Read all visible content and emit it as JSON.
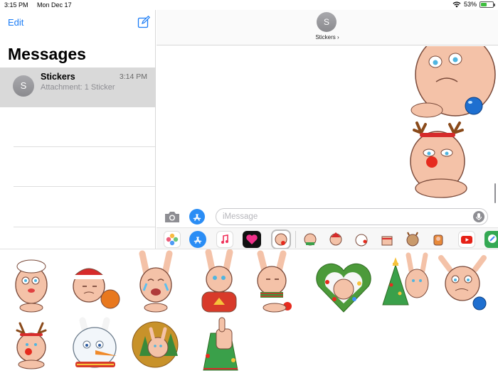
{
  "status": {
    "time": "3:15 PM",
    "date": "Mon Dec 17",
    "battery": "53%",
    "battery_level": 0.53
  },
  "sidebar": {
    "edit_label": "Edit",
    "title": "Messages"
  },
  "conversation": {
    "avatar_letter": "S",
    "name": "Stickers",
    "time": "3:14 PM",
    "preview": "Attachment: 1 Sticker"
  },
  "thread": {
    "avatar_letter": "S",
    "name": "Stickers ›"
  },
  "input": {
    "placeholder": "iMessage"
  },
  "colors": {
    "accent": "#1a7cf5",
    "selected_row": "#d9d9d9",
    "sticker_fur": "#f4c2a8",
    "battery": "#3fbf3f"
  },
  "apps": [
    "photos-app-icon",
    "app-store-app-icon",
    "music-app-icon",
    "digital-touch-app-icon",
    "stickers-app-icon",
    "sticker-pack-icon",
    "sticker-pack-icon",
    "sticker-pack-icon",
    "sticker-pack-icon",
    "sticker-pack-icon",
    "sticker-pack-icon",
    "sticker-pack-icon",
    "youtube-app-icon",
    "maps-app-icon"
  ],
  "stickers": [
    "bunny-nightcap",
    "bunny-santa-hat",
    "bunny-laughing-tears",
    "bunny-christmas-sweater",
    "bunny-scarf-ornament",
    "bunny-wreath",
    "bunny-christmas-tree",
    "bunny-ornament",
    "reindeer-bunny",
    "snowman-bunny",
    "bunny-forest",
    "bunny-thumbs-up"
  ]
}
